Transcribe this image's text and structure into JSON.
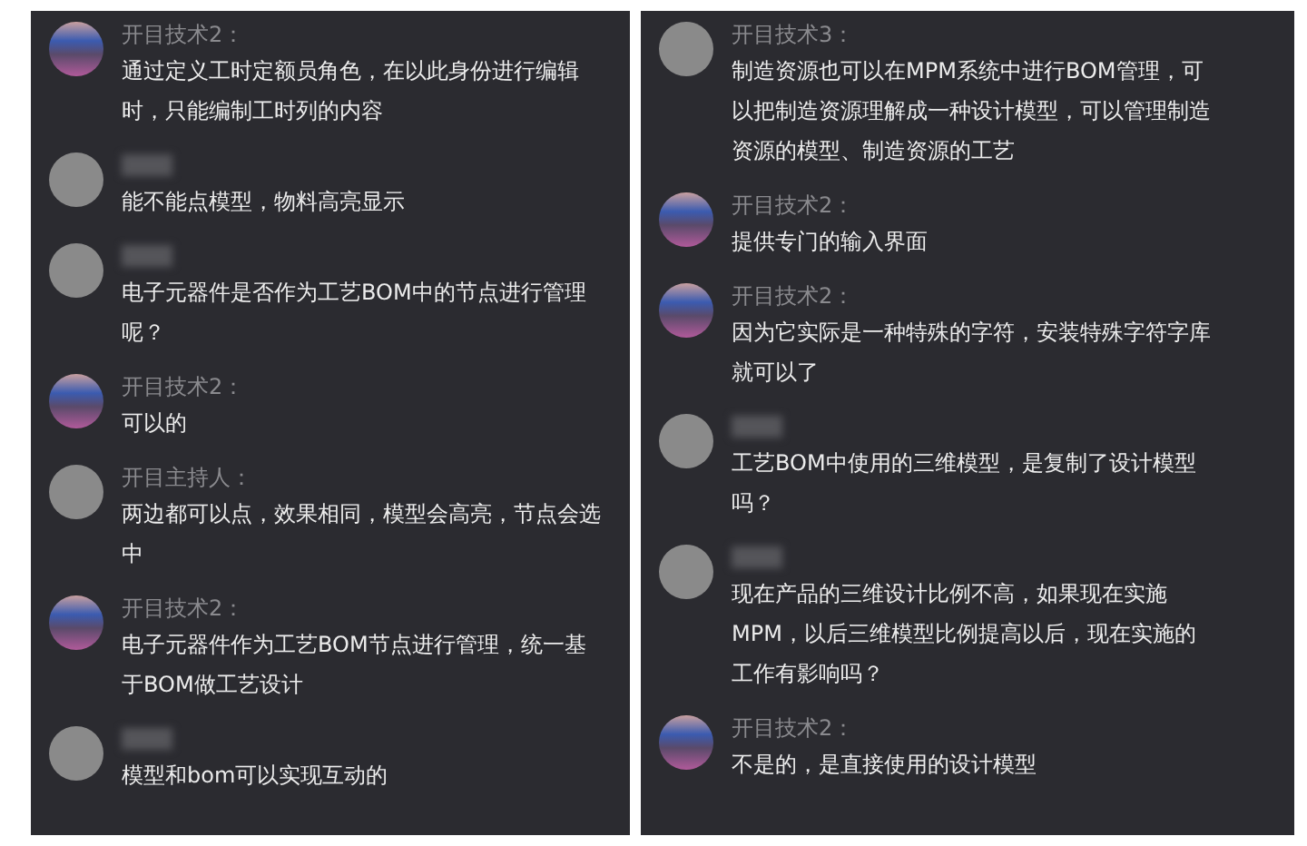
{
  "panels": [
    {
      "messages": [
        {
          "kind": "landscape",
          "sender": "开目技术2：",
          "text": "通过定义工时定额员角色，在以此身份进行编辑时，只能编制工时列的内容"
        },
        {
          "kind": "photo",
          "sender_hidden": true,
          "text": "能不能点模型，物料高亮显示"
        },
        {
          "kind": "photo",
          "sender_hidden": true,
          "text": "电子元器件是否作为工艺BOM中的节点进行管理呢？"
        },
        {
          "kind": "landscape",
          "sender": "开目技术2：",
          "text": "可以的"
        },
        {
          "kind": "photo",
          "sender": "开目主持人：",
          "text": "两边都可以点，效果相同，模型会高亮，节点会选中"
        },
        {
          "kind": "landscape",
          "sender": "开目技术2：",
          "text": "电子元器件作为工艺BOM节点进行管理，统一基于BOM做工艺设计"
        },
        {
          "kind": "photo",
          "sender_hidden": true,
          "text": "模型和bom可以实现互动的"
        }
      ]
    },
    {
      "messages": [
        {
          "kind": "photo",
          "sender": "开目技术3：",
          "text": "制造资源也可以在MPM系统中进行BOM管理，可以把制造资源理解成一种设计模型，可以管理制造资源的模型、制造资源的工艺"
        },
        {
          "kind": "landscape",
          "sender": "开目技术2：",
          "text": "提供专门的输入界面"
        },
        {
          "kind": "landscape",
          "sender": "开目技术2：",
          "text": "因为它实际是一种特殊的字符，安装特殊字符字库就可以了"
        },
        {
          "kind": "photo",
          "sender_hidden": true,
          "text": "工艺BOM中使用的三维模型，是复制了设计模型吗？"
        },
        {
          "kind": "photo",
          "sender_hidden": true,
          "text": "现在产品的三维设计比例不高，如果现在实施MPM，以后三维模型比例提高以后，现在实施的工作有影响吗？"
        },
        {
          "kind": "landscape",
          "sender": "开目技术2：",
          "text": "不是的，是直接使用的设计模型"
        }
      ]
    }
  ]
}
